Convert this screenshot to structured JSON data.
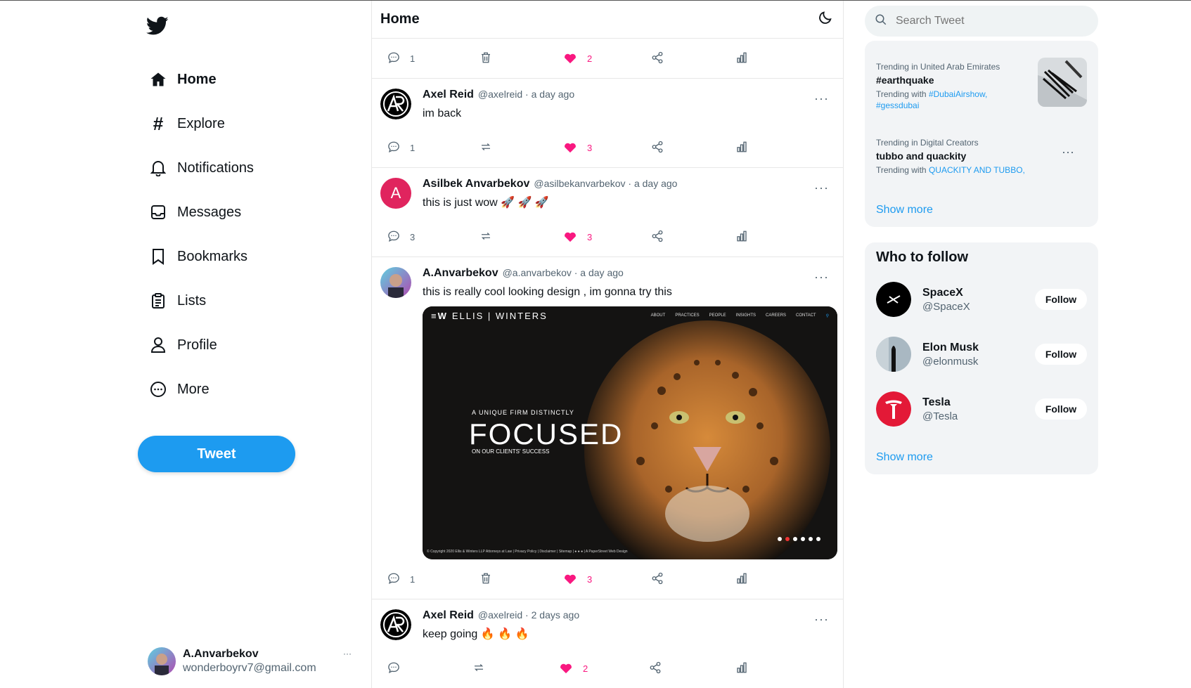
{
  "nav": {
    "items": [
      {
        "label": "Home",
        "icon": "home-icon"
      },
      {
        "label": "Explore",
        "icon": "hashtag-icon"
      },
      {
        "label": "Notifications",
        "icon": "bell-icon"
      },
      {
        "label": "Messages",
        "icon": "inbox-icon"
      },
      {
        "label": "Bookmarks",
        "icon": "bookmark-icon"
      },
      {
        "label": "Lists",
        "icon": "clipboard-icon"
      },
      {
        "label": "Profile",
        "icon": "user-icon"
      },
      {
        "label": "More",
        "icon": "more-circle-icon"
      }
    ],
    "tweet_button": "Tweet",
    "account": {
      "name": "A.Anvarbekov",
      "email": "wonderboyrv7@gmail.com",
      "more": "···"
    }
  },
  "feed": {
    "title": "Home",
    "top_actions": {
      "replies": "1",
      "likes": "2"
    },
    "tweets": [
      {
        "name": "Axel Reid",
        "meta": "@axelreid · a day ago",
        "text": "im back",
        "replies": "1",
        "likes": "3",
        "more": "···"
      },
      {
        "name": "Asilbek Anvarbekov",
        "meta": "@asilbekanvarbekov · a day ago",
        "text": "this is just wow 🚀 🚀 🚀",
        "avatar_letter": "A",
        "replies": "3",
        "likes": "3",
        "more": "···"
      },
      {
        "name": "A.Anvarbekov",
        "meta": "@a.anvarbekov · a day ago",
        "text": "this is really cool looking design , im gonna try this",
        "replies": "1",
        "likes": "3",
        "more": "···",
        "media": {
          "brand": "ELLIS | WINTERS",
          "menu": [
            "ABOUT",
            "PRACTICES",
            "PEOPLE",
            "INSIGHTS",
            "CAREERS",
            "CONTACT"
          ],
          "kicker": "A UNIQUE FIRM DISTINCTLY",
          "headline": "FOCUSED",
          "sub": "ON OUR CLIENTS' SUCCESS",
          "footer": "© Copyright 2020 Ellis & Winters LLP Attorneys at Law  |  Privacy Policy  |  Disclaimer  |  Sitemap  |  ● ● ●  |  A PaperStreet Web Design"
        }
      },
      {
        "name": "Axel Reid",
        "meta": "@axelreid · 2 days ago",
        "text": "keep going 🔥 🔥 🔥",
        "likes": "2",
        "more": "···"
      }
    ]
  },
  "sidebar": {
    "search_placeholder": "Search Tweet",
    "trends": [
      {
        "meta": "Trending in United Arab Emirates",
        "name": "#earthquake",
        "with_label": "Trending with ",
        "with_tags": "#DubaiAirshow, #gessdubai"
      },
      {
        "meta": "Trending in Digital Creators",
        "name": "tubbo and quackity",
        "with_label": "Trending with ",
        "with_tags": "QUACKITY AND TUBBO,",
        "more": "···"
      }
    ],
    "trends_show_more": "Show more",
    "who_to_follow": {
      "title": "Who to follow",
      "users": [
        {
          "name": "SpaceX",
          "handle": "@SpaceX",
          "button": "Follow"
        },
        {
          "name": "Elon Musk",
          "handle": "@elonmusk",
          "button": "Follow"
        },
        {
          "name": "Tesla",
          "handle": "@Tesla",
          "button": "Follow"
        }
      ],
      "show_more": "Show more"
    }
  },
  "colors": {
    "accent": "#1d9bf0",
    "like": "#f91880",
    "avatar_pink": "#e0245e",
    "tesla_red": "#e31937"
  }
}
